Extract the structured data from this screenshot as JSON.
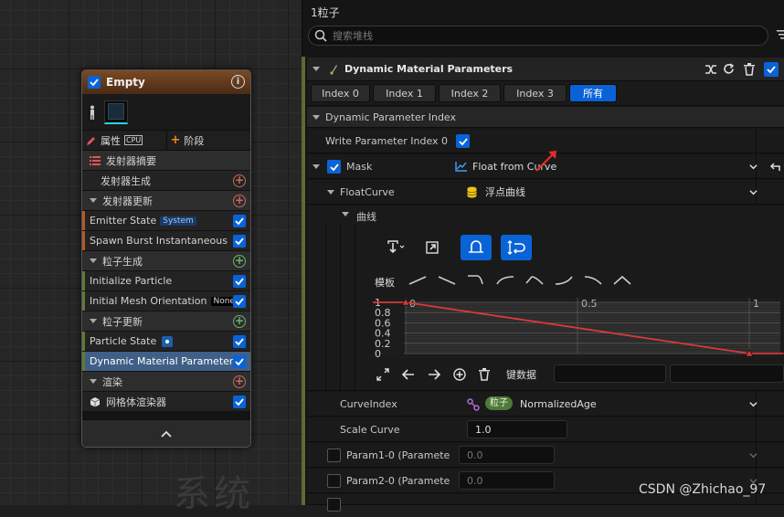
{
  "graph": {
    "ghost_text": "系统"
  },
  "node": {
    "title": "Empty",
    "info_icon": "i",
    "tab_properties": "属性",
    "tab_cpu": "CPU",
    "tab_stage": "阶段",
    "rows": {
      "emitter_summary": "发射器摘要",
      "emitter_spawn": "发射器生成",
      "emitter_update": "发射器更新",
      "emitter_state": "Emitter State",
      "emitter_state_tag": "System",
      "spawn_burst": "Spawn Burst Instantaneous",
      "particle_spawn": "粒子生成",
      "initialize_particle": "Initialize Particle",
      "initial_mesh_orientation": "Initial Mesh Orientation",
      "initial_mesh_tag": "None",
      "particle_update": "粒子更新",
      "particle_state": "Particle State",
      "dynamic_material_parameters": "Dynamic Material Parameters",
      "render": "渲染",
      "mesh_renderer": "网格体渲染器"
    },
    "colors": {
      "header": "#7a4a25",
      "accent": "#0a63d6",
      "selected": "#3f5f86"
    }
  },
  "panel": {
    "title": "1粒子",
    "search_placeholder": "搜索堆栈",
    "module_title": "Dynamic Material Parameters",
    "index_tabs": [
      "Index 0",
      "Index 1",
      "Index 2",
      "Index 3",
      "所有"
    ],
    "active_tab": "所有",
    "dynamic_parameter_index": "Dynamic Parameter Index",
    "write_parameter_index": "Write Parameter Index 0",
    "mask_label": "Mask",
    "mask_value": "Float from Curve",
    "floatcurve_label": "FloatCurve",
    "floatcurve_value": "浮点曲线",
    "curve_label": "曲线",
    "template_label": "模板",
    "keydata_label": "键数据",
    "curveindex_label": "CurveIndex",
    "curveindex_tag": "粒子",
    "curveindex_value": "NormalizedAge",
    "scalecurve_label": "Scale Curve",
    "scalecurve_value": "1.0",
    "param1_label": "Param1-0 (Paramete",
    "param1_value": "0.0",
    "param2_label": "Param2-0 (Paramete",
    "param2_value": "0.0"
  },
  "chart_data": {
    "type": "line",
    "x": [
      0,
      1,
      1.1
    ],
    "y": [
      1,
      0,
      0
    ],
    "x_ticks": [
      "0",
      "0.5",
      "1"
    ],
    "y_ticks": [
      "1",
      "0.8",
      "0.6",
      "0.4",
      "0.2",
      "0"
    ],
    "keys": [
      [
        0,
        1
      ],
      [
        1,
        0
      ]
    ],
    "series_color": "#d83a3a",
    "grid": true
  },
  "watermark": "CSDN @Zhichao_97"
}
